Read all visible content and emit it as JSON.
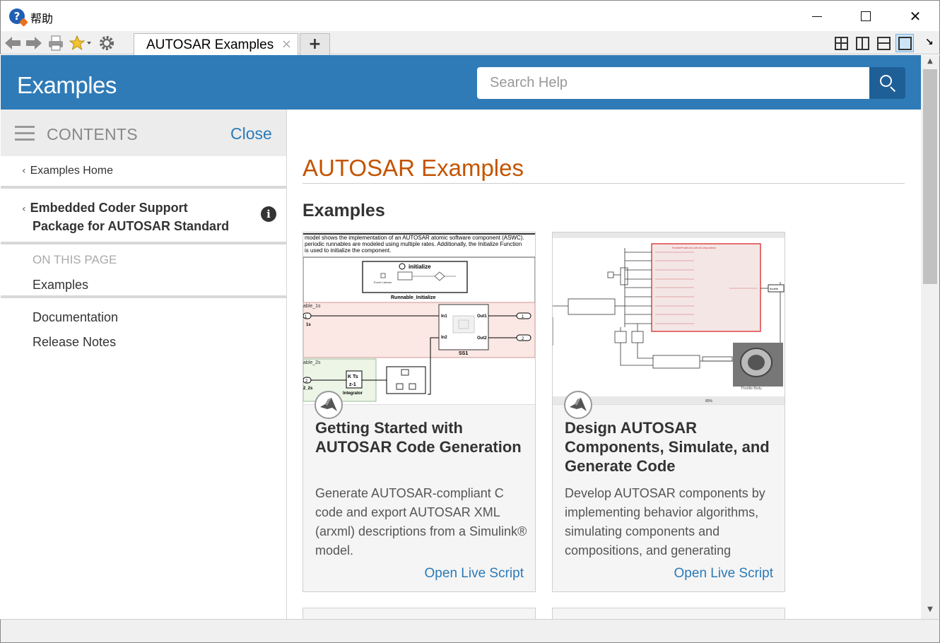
{
  "window": {
    "title": "帮助",
    "icon": "help-question-icon"
  },
  "toolbar": {
    "icons": [
      "back-arrow-icon",
      "forward-arrow-icon",
      "print-icon",
      "favorites-star-icon",
      "settings-gear-icon"
    ],
    "tab_label": "AUTOSAR Examples",
    "tab_close": "×",
    "add_tab": "+"
  },
  "header": {
    "title": "Examples",
    "search_placeholder": "Search Help"
  },
  "sidebar": {
    "contents_label": "CONTENTS",
    "close_label": "Close",
    "home_link": "Examples Home",
    "parent_line1": "Embedded Coder Support",
    "parent_line2": "Package for AUTOSAR Standard",
    "on_this_page": "ON THIS PAGE",
    "on_page_items": [
      "Examples"
    ],
    "links": [
      "Documentation",
      "Release Notes"
    ]
  },
  "main": {
    "page_title": "AUTOSAR Examples",
    "section_title": "Examples",
    "cards": [
      {
        "title": "Getting Started with AUTOSAR Code Generation",
        "description": "Generate AUTOSAR-compliant C code and export AUTOSAR XML (arxml) descriptions from a Simulink® model.",
        "link": "Open Live Script",
        "thumb": {
          "caption1": "model shows the implementation of an AUTOSAR atomic software component (ASWC).",
          "caption2": "periodic runnables are modeled using multiple rates. Additionally, the Initialize Function",
          "caption3": "is used to initialize the component.",
          "init_block": "initialize",
          "init_sub": "Runnable_Initialize",
          "event_listener": "Event Listener",
          "runnable1": "able_1s",
          "in1": "In1",
          "in2": "In2",
          "out1": "Out1",
          "out2": "Out2",
          "ss1": "SS1",
          "port1": "1",
          "port2": "2",
          "port_1s": "1s",
          "runnable2": "able_2s",
          "port_2s": "2_2s",
          "integrator": "Integrator",
          "kts": "K Ts",
          "zminus": "z-1"
        }
      },
      {
        "title": "Design AUTOSAR Components, Simulate, and Generate Code",
        "description": "Develop AUTOSAR components by implementing behavior algorithms, simulating components and compositions, and generating",
        "link": "Open Live Script",
        "thumb": {
          "composition": "ThrottlePositionControlComposition",
          "double": "double",
          "throttle_body": "Throttle Body",
          "zoom": "80%"
        }
      }
    ]
  }
}
